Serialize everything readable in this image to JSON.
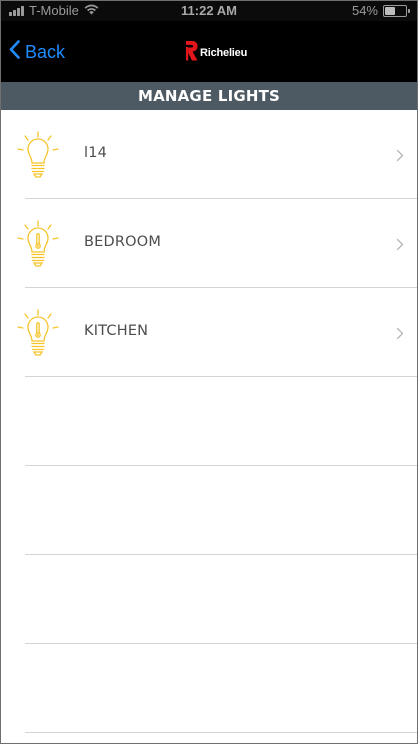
{
  "status_bar": {
    "carrier": "T-Mobile",
    "time": "11:22 AM",
    "battery_percent": "54%",
    "battery_level": 0.54,
    "icons": [
      "signal-icon",
      "wifi-icon",
      "battery-icon"
    ]
  },
  "nav": {
    "back_label": "Back",
    "logo_text": "Richelieu",
    "colors": {
      "back": "#1f8cff",
      "logo_mark": "#e3161b",
      "bar": "#000000"
    }
  },
  "title_bar": {
    "title": "MANAGE LIGHTS",
    "color": "#4e5a63"
  },
  "lights": [
    {
      "label": "l14",
      "icon": "lightbulb-icon"
    },
    {
      "label": "BEDROOM",
      "icon": "lightbulb-thermometer-icon"
    },
    {
      "label": "KITCHEN",
      "icon": "lightbulb-thermometer-icon"
    }
  ],
  "empty_rows": 4,
  "accent_colors": {
    "bulb": "#f5c42b",
    "divider": "#d4d4d4",
    "chevron": "#b8b8b8"
  }
}
